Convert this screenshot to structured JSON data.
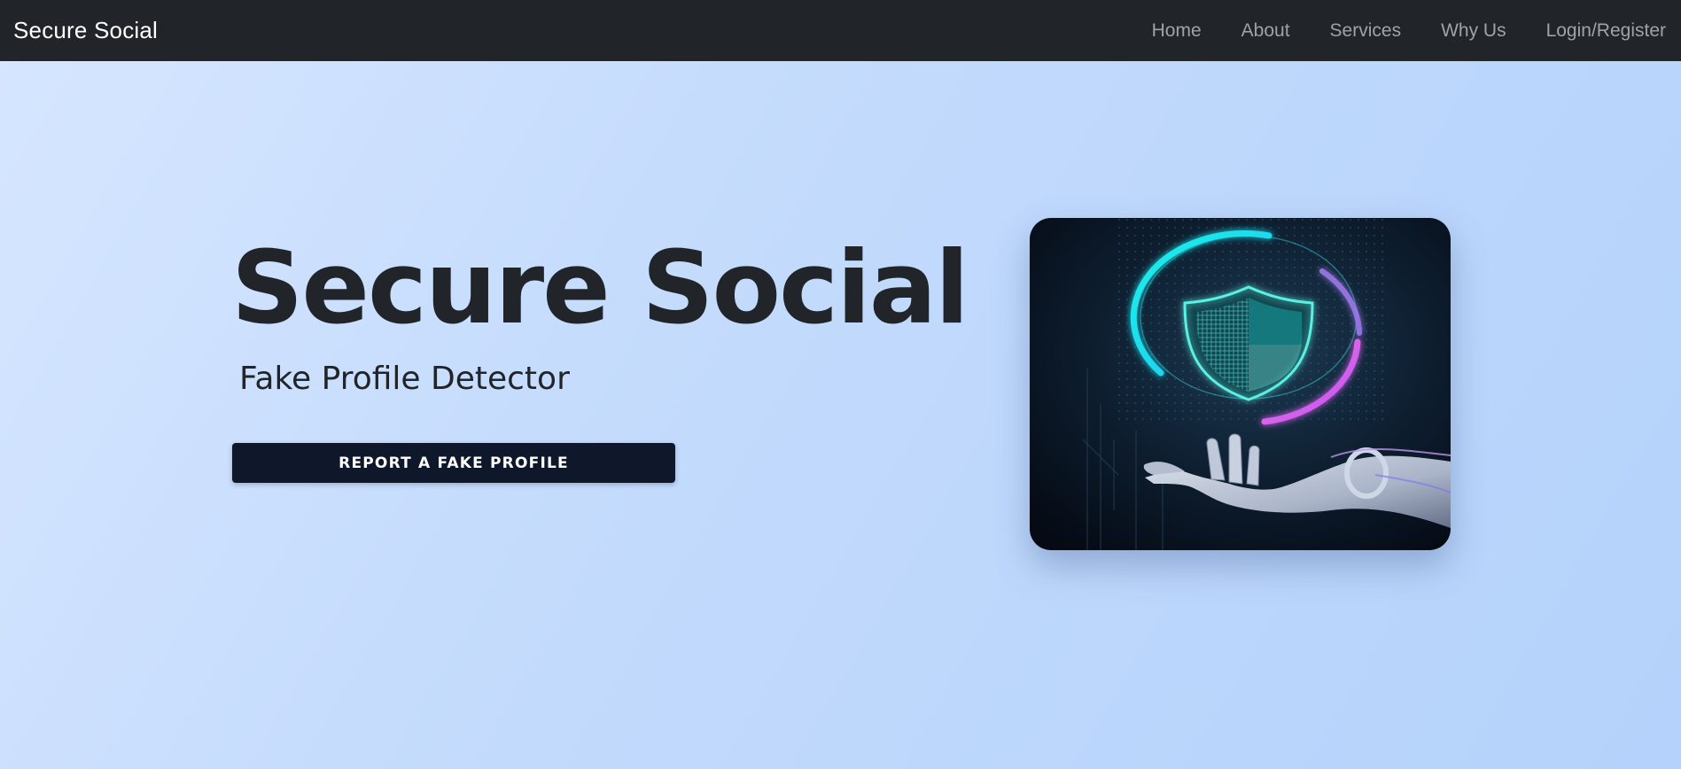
{
  "navbar": {
    "brand": "Secure Social",
    "links": [
      {
        "label": "Home"
      },
      {
        "label": "About"
      },
      {
        "label": "Services"
      },
      {
        "label": "Why Us"
      },
      {
        "label": "Login/Register"
      }
    ]
  },
  "hero": {
    "title": "Secure Social",
    "subtitle": "Fake Profile Detector",
    "cta_label": "REPORT A FAKE PROFILE",
    "image": {
      "icon": "shield-icon",
      "colors": {
        "cyan": "#19f0ea",
        "magenta": "#e15cf0",
        "background": "#0b1524"
      }
    }
  },
  "colors": {
    "navbar_bg": "#212529",
    "text_dark": "#212529",
    "button_bg": "#0f172a"
  }
}
